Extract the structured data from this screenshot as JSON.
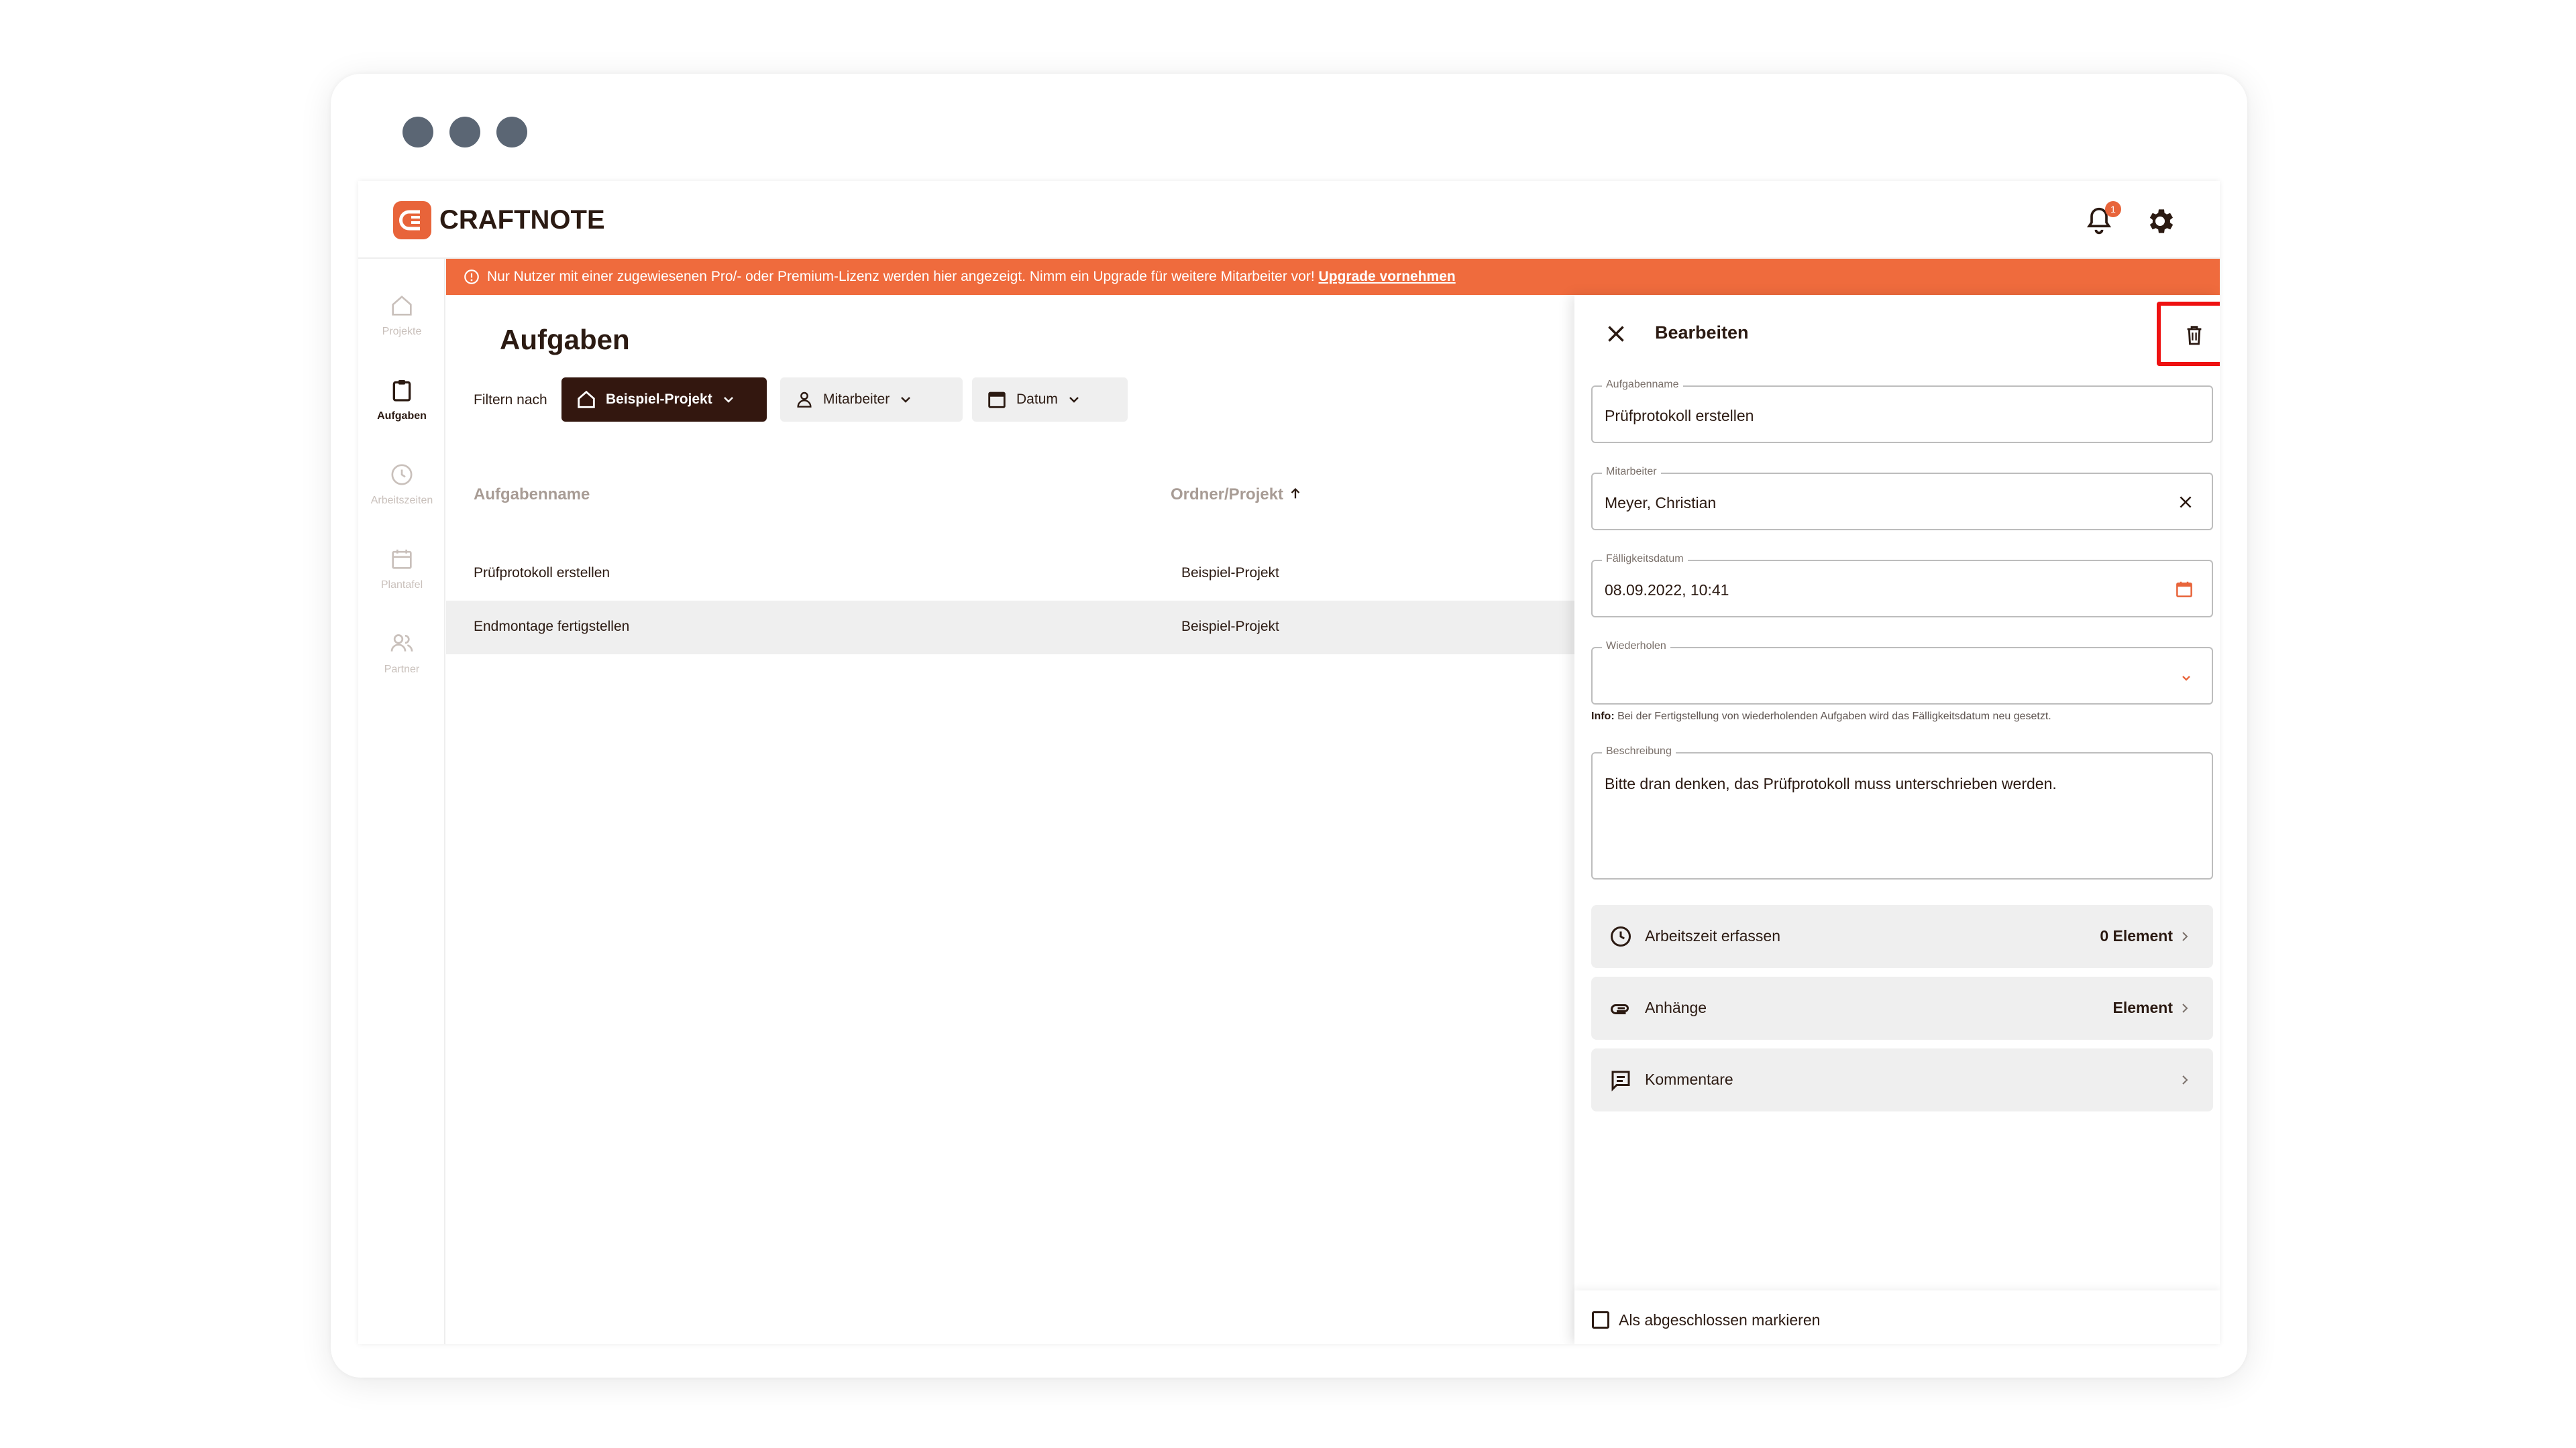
{
  "app": {
    "name": "CRAFTNOTE",
    "notification_count": "1"
  },
  "sidebar": {
    "items": [
      {
        "label": "Projekte",
        "icon": "home-icon",
        "active": false
      },
      {
        "label": "Aufgaben",
        "icon": "clipboard-icon",
        "active": true
      },
      {
        "label": "Arbeitszeiten",
        "icon": "clock-icon",
        "active": false
      },
      {
        "label": "Plantafel",
        "icon": "calendar-icon",
        "active": false
      },
      {
        "label": "Partner",
        "icon": "people-icon",
        "active": false
      }
    ]
  },
  "banner": {
    "text": "Nur Nutzer mit einer zugewiesenen Pro/- oder Premium-Lizenz werden hier angezeigt. Nimm ein Upgrade für weitere Mitarbeiter vor!",
    "link": "Upgrade vornehmen"
  },
  "main": {
    "title": "Aufgaben",
    "filter_label": "Filtern nach",
    "filters": [
      {
        "label": "Beispiel-Projekt",
        "active": true
      },
      {
        "label": "Mitarbeiter",
        "active": false
      },
      {
        "label": "Datum",
        "active": false
      }
    ],
    "columns": [
      "Aufgabenname",
      "Ordner/Projekt"
    ],
    "rows": [
      {
        "name": "Prüfprotokoll erstellen",
        "project": "Beispiel-Projekt"
      },
      {
        "name": "Endmontage fertigstellen",
        "project": "Beispiel-Projekt"
      }
    ]
  },
  "panel": {
    "title": "Bearbeiten",
    "fields": {
      "task_name": {
        "label": "Aufgabenname",
        "value": "Prüfprotokoll erstellen"
      },
      "employee": {
        "label": "Mitarbeiter",
        "value": "Meyer, Christian"
      },
      "due_date": {
        "label": "Fälligkeitsdatum",
        "value": "08.09.2022, 10:41"
      },
      "repeat": {
        "label": "Wiederholen",
        "value": ""
      },
      "description": {
        "label": "Beschreibung",
        "value": "Bitte dran denken, das Prüfprotokoll muss unterschrieben werden."
      }
    },
    "info_prefix": "Info:",
    "info_text": "Bei der Fertigstellung von wiederholenden Aufgaben wird das Fälligkeitsdatum neu gesetzt.",
    "actions": [
      {
        "label": "Arbeitszeit erfassen",
        "count": "0 Element",
        "icon": "clock-icon"
      },
      {
        "label": "Anhänge",
        "count": "Element",
        "icon": "paperclip-icon"
      },
      {
        "label": "Kommentare",
        "count": "",
        "icon": "comment-icon"
      }
    ],
    "complete_label": "Als abgeschlossen markieren"
  },
  "colors": {
    "accent": "#ef6b3d",
    "dark": "#33170f",
    "highlight": "#ee1111"
  }
}
